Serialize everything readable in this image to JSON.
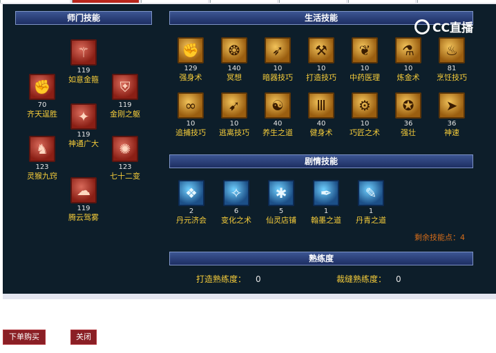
{
  "headers": {
    "shimen": "师门技能",
    "life": "生活技能",
    "plot": "剧情技能",
    "proficiency": "熟练度"
  },
  "watermark": "CC直播",
  "shimen_skills": [
    {
      "name": "如意金箍",
      "level": "119",
      "icon": "staff-icon"
    },
    {
      "name": "齐天逞胜",
      "level": "70",
      "icon": "monkey-king-icon"
    },
    {
      "name": "金刚之躯",
      "level": "119",
      "icon": "armor-icon"
    },
    {
      "name": "神通广大",
      "level": "119",
      "icon": "power-icon"
    },
    {
      "name": "灵猴九窍",
      "level": "123",
      "icon": "monkey-icon"
    },
    {
      "name": "七十二变",
      "level": "123",
      "icon": "transform-icon"
    },
    {
      "name": "腾云驾雾",
      "level": "119",
      "icon": "cloud-icon"
    }
  ],
  "life_skills": [
    {
      "name": "强身术",
      "level": "129",
      "icon": "fist-icon"
    },
    {
      "name": "冥想",
      "level": "140",
      "icon": "meditate-icon"
    },
    {
      "name": "暗器技巧",
      "level": "10",
      "icon": "dart-icon"
    },
    {
      "name": "打造技巧",
      "level": "10",
      "icon": "hammer-icon"
    },
    {
      "name": "中药医理",
      "level": "10",
      "icon": "herb-icon"
    },
    {
      "name": "炼金术",
      "level": "10",
      "icon": "alchemy-icon"
    },
    {
      "name": "烹饪技巧",
      "level": "81",
      "icon": "cooking-icon"
    },
    {
      "name": "追捕技巧",
      "level": "10",
      "icon": "chain-icon"
    },
    {
      "name": "逃离技巧",
      "level": "10",
      "icon": "escape-icon"
    },
    {
      "name": "养生之道",
      "level": "40",
      "icon": "health-icon"
    },
    {
      "name": "健身术",
      "level": "40",
      "icon": "fitness-icon"
    },
    {
      "name": "巧匠之术",
      "level": "10",
      "icon": "craft-icon"
    },
    {
      "name": "强壮",
      "level": "36",
      "icon": "strong-icon"
    },
    {
      "name": "神速",
      "level": "36",
      "icon": "speed-icon"
    }
  ],
  "plot_skills": [
    {
      "name": "丹元济会",
      "level": "2",
      "icon": "elixir-icon"
    },
    {
      "name": "变化之术",
      "level": "6",
      "icon": "change-icon"
    },
    {
      "name": "仙灵店铺",
      "level": "5",
      "icon": "shop-icon"
    },
    {
      "name": "翰墨之道",
      "level": "1",
      "icon": "ink-icon"
    },
    {
      "name": "丹青之道",
      "level": "1",
      "icon": "painting-icon"
    }
  ],
  "remaining_points": "剩余技能点：4",
  "proficiency": {
    "forge_label": "打造熟练度：",
    "forge_value": "0",
    "tailor_label": "裁缝熟练度：",
    "tailor_value": "0"
  },
  "buttons": {
    "buy": "下单购买",
    "close": "关闭"
  },
  "colors": {
    "panel_bg": "#0d1e2a",
    "header_bg": "#2a407a",
    "skill_name": "#f5cc3a",
    "level_text": "#e6e6e6",
    "remaining_text": "#d46c1a",
    "button_bg": "#8a1f25",
    "active_tab": "#b8261c"
  }
}
